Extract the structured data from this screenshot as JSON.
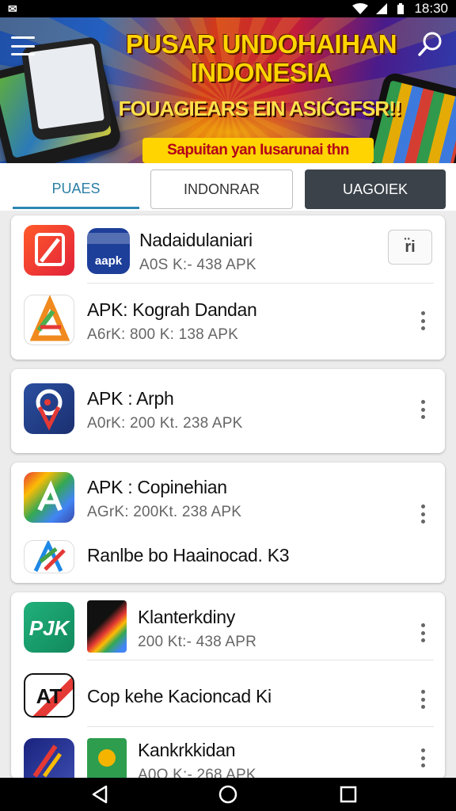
{
  "status_bar": {
    "left_icon": "notification-icon",
    "time": "18:30"
  },
  "banner": {
    "title": "PUSAR UNDOHAIHAN INDONESIA",
    "subtitle": "FOUAGIEARS EIN ASIĆGFSR!!",
    "tagline": "Sapuitan yan Iusarunai thn maichl!",
    "colors": {
      "title": "#ffd400",
      "tagline_bg": "#ffd400",
      "tagline_text": "#b3001a"
    }
  },
  "tabs": [
    {
      "label": "PUAES",
      "active": true
    },
    {
      "label": "INDONRAR",
      "active": false
    },
    {
      "label": "UAGOIEK",
      "active": false
    }
  ],
  "cards": [
    {
      "rows": [
        {
          "title": "Nadaidulaniari",
          "meta": "A0S K:- 438 APK",
          "icon_text": "aapk",
          "action": "install-button",
          "action_label": "r̈i"
        },
        {
          "title": "APK: Kograh Dandan",
          "meta": "A6rK: 800 K: 138 APK"
        }
      ]
    },
    {
      "rows": [
        {
          "title": "APK : Arph",
          "meta": "A0rK: 200 Kt. 238 APK"
        }
      ]
    },
    {
      "rows": [
        {
          "title": "APK : Copinehian",
          "meta": "AGrK: 200Kt. 238 APK"
        },
        {
          "title": "Ranlbe bo Haainocad. K3",
          "meta": ""
        }
      ]
    },
    {
      "rows": [
        {
          "title": "Klanterkdiny",
          "meta": "200 Kt:- 438 APR",
          "icon_text": "PJK"
        },
        {
          "title": "Cop kehe Kacioncad Ki",
          "meta": "",
          "icon_text": "AT"
        },
        {
          "title": "Kankrkkidan",
          "meta": "A0O K:- 268 APK"
        }
      ]
    }
  ],
  "colors": {
    "accent": "#2c86b4",
    "tab_dark": "#3b4249"
  }
}
